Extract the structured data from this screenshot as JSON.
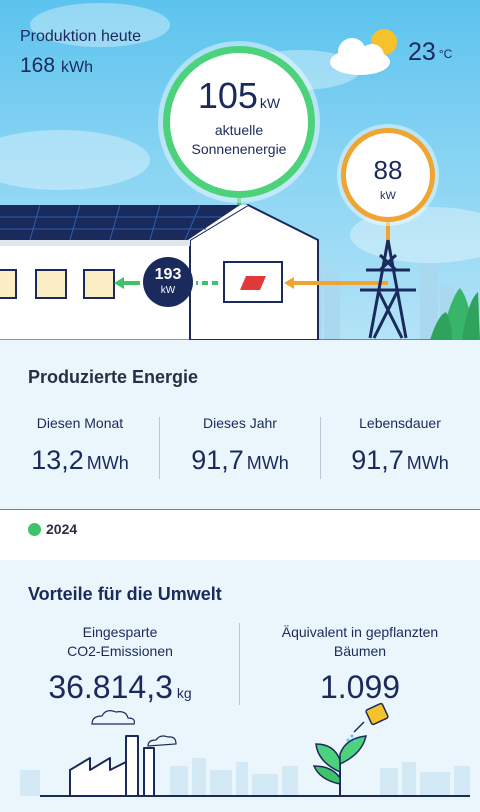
{
  "production": {
    "label": "Produktion heute",
    "value": "168",
    "unit": "kWh"
  },
  "weather": {
    "temperature": "23",
    "unit": "°C",
    "icon": "partly-cloudy-icon"
  },
  "solar": {
    "value": "105",
    "unit": "kW",
    "label_line1": "aktuelle",
    "label_line2": "Sonnenenergie"
  },
  "grid": {
    "value": "88",
    "unit": "kW"
  },
  "house": {
    "value": "193",
    "unit": "kW"
  },
  "energy": {
    "title": "Produzierte Energie",
    "stats": [
      {
        "label": "Diesen Monat",
        "value": "13,2",
        "unit": "MWh"
      },
      {
        "label": "Dieses Jahr",
        "value": "91,7",
        "unit": "MWh"
      },
      {
        "label": "Lebensdauer",
        "value": "91,7",
        "unit": "MWh"
      }
    ]
  },
  "year": {
    "label": "2024"
  },
  "environment": {
    "title": "Vorteile für die Umwelt",
    "co2": {
      "label_line1": "Eingesparte",
      "label_line2": "CO2-Emissionen",
      "value": "36.814,3",
      "unit": "kg"
    },
    "trees": {
      "label_line1": "Äquivalent in gepflanzten",
      "label_line2": "Bäumen",
      "value": "1.099"
    }
  },
  "colors": {
    "solar_ring": "#4bd27a",
    "grid_ring": "#f0a431",
    "navy": "#1b2a5c",
    "green_dot": "#3ec26a"
  }
}
